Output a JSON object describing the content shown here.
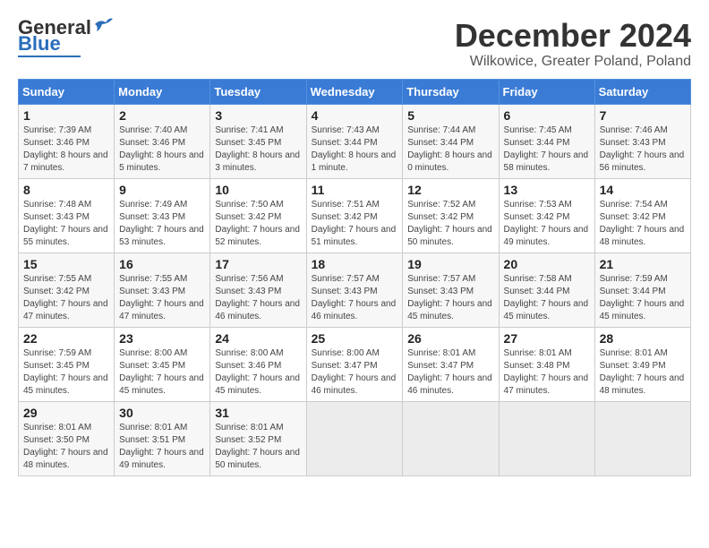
{
  "header": {
    "logo_general": "General",
    "logo_blue": "Blue",
    "month_title": "December 2024",
    "location": "Wilkowice, Greater Poland, Poland"
  },
  "weekdays": [
    "Sunday",
    "Monday",
    "Tuesday",
    "Wednesday",
    "Thursday",
    "Friday",
    "Saturday"
  ],
  "weeks": [
    [
      {
        "day": "1",
        "sunrise": "7:39 AM",
        "sunset": "3:46 PM",
        "daylight": "8 hours and 7 minutes."
      },
      {
        "day": "2",
        "sunrise": "7:40 AM",
        "sunset": "3:46 PM",
        "daylight": "8 hours and 5 minutes."
      },
      {
        "day": "3",
        "sunrise": "7:41 AM",
        "sunset": "3:45 PM",
        "daylight": "8 hours and 3 minutes."
      },
      {
        "day": "4",
        "sunrise": "7:43 AM",
        "sunset": "3:44 PM",
        "daylight": "8 hours and 1 minute."
      },
      {
        "day": "5",
        "sunrise": "7:44 AM",
        "sunset": "3:44 PM",
        "daylight": "8 hours and 0 minutes."
      },
      {
        "day": "6",
        "sunrise": "7:45 AM",
        "sunset": "3:44 PM",
        "daylight": "7 hours and 58 minutes."
      },
      {
        "day": "7",
        "sunrise": "7:46 AM",
        "sunset": "3:43 PM",
        "daylight": "7 hours and 56 minutes."
      }
    ],
    [
      {
        "day": "8",
        "sunrise": "7:48 AM",
        "sunset": "3:43 PM",
        "daylight": "7 hours and 55 minutes."
      },
      {
        "day": "9",
        "sunrise": "7:49 AM",
        "sunset": "3:43 PM",
        "daylight": "7 hours and 53 minutes."
      },
      {
        "day": "10",
        "sunrise": "7:50 AM",
        "sunset": "3:42 PM",
        "daylight": "7 hours and 52 minutes."
      },
      {
        "day": "11",
        "sunrise": "7:51 AM",
        "sunset": "3:42 PM",
        "daylight": "7 hours and 51 minutes."
      },
      {
        "day": "12",
        "sunrise": "7:52 AM",
        "sunset": "3:42 PM",
        "daylight": "7 hours and 50 minutes."
      },
      {
        "day": "13",
        "sunrise": "7:53 AM",
        "sunset": "3:42 PM",
        "daylight": "7 hours and 49 minutes."
      },
      {
        "day": "14",
        "sunrise": "7:54 AM",
        "sunset": "3:42 PM",
        "daylight": "7 hours and 48 minutes."
      }
    ],
    [
      {
        "day": "15",
        "sunrise": "7:55 AM",
        "sunset": "3:42 PM",
        "daylight": "7 hours and 47 minutes."
      },
      {
        "day": "16",
        "sunrise": "7:55 AM",
        "sunset": "3:43 PM",
        "daylight": "7 hours and 47 minutes."
      },
      {
        "day": "17",
        "sunrise": "7:56 AM",
        "sunset": "3:43 PM",
        "daylight": "7 hours and 46 minutes."
      },
      {
        "day": "18",
        "sunrise": "7:57 AM",
        "sunset": "3:43 PM",
        "daylight": "7 hours and 46 minutes."
      },
      {
        "day": "19",
        "sunrise": "7:57 AM",
        "sunset": "3:43 PM",
        "daylight": "7 hours and 45 minutes."
      },
      {
        "day": "20",
        "sunrise": "7:58 AM",
        "sunset": "3:44 PM",
        "daylight": "7 hours and 45 minutes."
      },
      {
        "day": "21",
        "sunrise": "7:59 AM",
        "sunset": "3:44 PM",
        "daylight": "7 hours and 45 minutes."
      }
    ],
    [
      {
        "day": "22",
        "sunrise": "7:59 AM",
        "sunset": "3:45 PM",
        "daylight": "7 hours and 45 minutes."
      },
      {
        "day": "23",
        "sunrise": "8:00 AM",
        "sunset": "3:45 PM",
        "daylight": "7 hours and 45 minutes."
      },
      {
        "day": "24",
        "sunrise": "8:00 AM",
        "sunset": "3:46 PM",
        "daylight": "7 hours and 45 minutes."
      },
      {
        "day": "25",
        "sunrise": "8:00 AM",
        "sunset": "3:47 PM",
        "daylight": "7 hours and 46 minutes."
      },
      {
        "day": "26",
        "sunrise": "8:01 AM",
        "sunset": "3:47 PM",
        "daylight": "7 hours and 46 minutes."
      },
      {
        "day": "27",
        "sunrise": "8:01 AM",
        "sunset": "3:48 PM",
        "daylight": "7 hours and 47 minutes."
      },
      {
        "day": "28",
        "sunrise": "8:01 AM",
        "sunset": "3:49 PM",
        "daylight": "7 hours and 48 minutes."
      }
    ],
    [
      {
        "day": "29",
        "sunrise": "8:01 AM",
        "sunset": "3:50 PM",
        "daylight": "7 hours and 48 minutes."
      },
      {
        "day": "30",
        "sunrise": "8:01 AM",
        "sunset": "3:51 PM",
        "daylight": "7 hours and 49 minutes."
      },
      {
        "day": "31",
        "sunrise": "8:01 AM",
        "sunset": "3:52 PM",
        "daylight": "7 hours and 50 minutes."
      },
      null,
      null,
      null,
      null
    ]
  ],
  "labels": {
    "sunrise_prefix": "Sunrise: ",
    "sunset_prefix": "Sunset: ",
    "daylight_prefix": "Daylight: "
  }
}
